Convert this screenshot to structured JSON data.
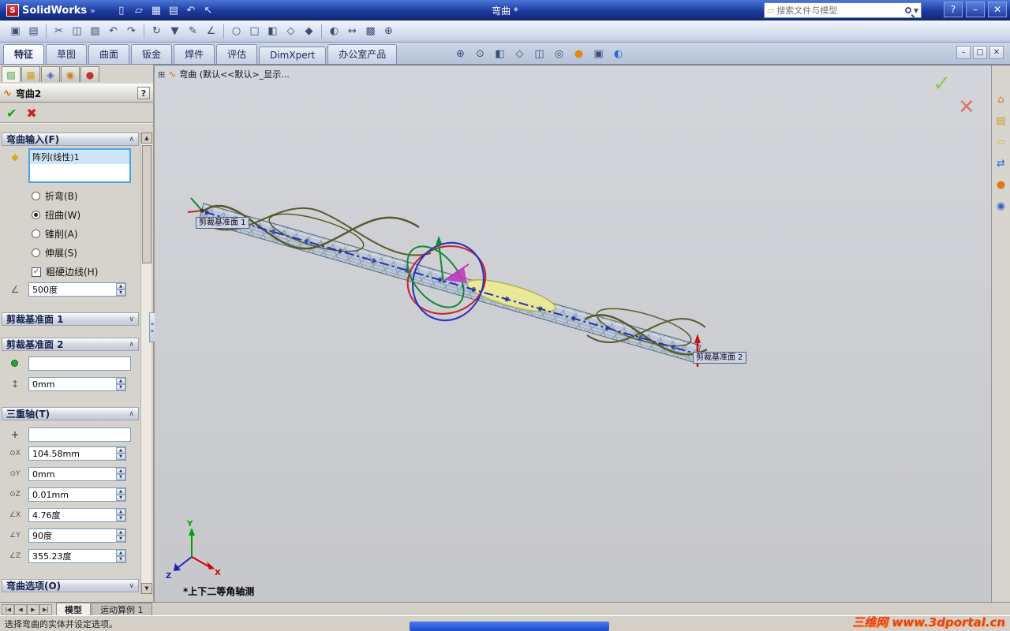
{
  "titlebar": {
    "app_name": "SolidWorks",
    "logo_chevron": "»",
    "doc_title": "弯曲 *",
    "search_placeholder": "搜索文件与模型",
    "icons": [
      {
        "name": "new-icon",
        "glyph": "▯"
      },
      {
        "name": "open-icon",
        "glyph": "▱"
      },
      {
        "name": "save-icon",
        "glyph": "▦"
      },
      {
        "name": "print-icon",
        "glyph": "▤"
      },
      {
        "name": "undo-icon",
        "glyph": "↶"
      },
      {
        "name": "select-icon",
        "glyph": "↖"
      }
    ],
    "window_controls": {
      "help": "?",
      "minimize": "–",
      "close": "✕"
    }
  },
  "toolbar2": {
    "icons": [
      {
        "name": "screen-capture-icon",
        "glyph": "▣"
      },
      {
        "name": "print-preview-icon",
        "glyph": "▤"
      },
      {
        "sep": true
      },
      {
        "name": "cut-icon",
        "glyph": "✂"
      },
      {
        "name": "copy-icon",
        "glyph": "◫"
      },
      {
        "name": "paste-icon",
        "glyph": "▨"
      },
      {
        "name": "undo-icon",
        "glyph": "↶"
      },
      {
        "name": "redo-icon",
        "glyph": "↷"
      },
      {
        "sep": true
      },
      {
        "name": "rebuild-icon",
        "glyph": "↻"
      },
      {
        "name": "selection-filter-icon",
        "glyph": "▼"
      },
      {
        "name": "sketch-icon",
        "glyph": "✎"
      },
      {
        "name": "smart-dimension-icon",
        "glyph": "∠"
      },
      {
        "sep": true
      },
      {
        "name": "circle-tool-icon",
        "glyph": "○"
      },
      {
        "name": "rectangle-tool-icon",
        "glyph": "□"
      },
      {
        "name": "mirror-icon",
        "glyph": "◧"
      },
      {
        "name": "wireframe-icon",
        "glyph": "◇"
      },
      {
        "name": "shaded-icon",
        "glyph": "◆"
      },
      {
        "sep": true
      },
      {
        "name": "section-view-icon",
        "glyph": "◐"
      },
      {
        "name": "measure-icon",
        "glyph": "↔"
      },
      {
        "name": "mass-properties-icon",
        "glyph": "▩"
      },
      {
        "name": "zoom-icon",
        "glyph": "⊕"
      }
    ]
  },
  "command_tabs": {
    "items": [
      {
        "name": "tab-features",
        "label": "特征",
        "active": true
      },
      {
        "name": "tab-sketch",
        "label": "草图"
      },
      {
        "name": "tab-surfaces",
        "label": "曲面"
      },
      {
        "name": "tab-sheet-metal",
        "label": "钣金"
      },
      {
        "name": "tab-weldments",
        "label": "焊件"
      },
      {
        "name": "tab-evaluate",
        "label": "评估"
      },
      {
        "name": "tab-dimxpert",
        "label": "DimXpert"
      },
      {
        "name": "tab-office-products",
        "label": "办公室产品"
      }
    ],
    "doc_controls": {
      "minimize": "–",
      "restore": "□",
      "close": "✕"
    }
  },
  "headsup": {
    "icons": [
      {
        "name": "zoom-fit-icon",
        "glyph": "⊕"
      },
      {
        "name": "zoom-area-icon",
        "glyph": "⊙"
      },
      {
        "name": "section-view-icon",
        "glyph": "◧"
      },
      {
        "name": "view-orientation-icon",
        "glyph": "◇"
      },
      {
        "name": "display-style-icon",
        "glyph": "◫"
      },
      {
        "name": "hide-show-icon",
        "glyph": "◎"
      },
      {
        "name": "edit-appearance-icon",
        "glyph": "●",
        "color": "#e08818"
      },
      {
        "name": "apply-scene-icon",
        "glyph": "▣"
      },
      {
        "name": "view-settings-icon",
        "glyph": "◐",
        "color": "#2a6ad0"
      }
    ]
  },
  "pm": {
    "tabs": [
      {
        "name": "propertymanager-tab",
        "glyph": "▧",
        "color": "#3a9a3a",
        "active": true
      },
      {
        "name": "configurationmanager-tab",
        "glyph": "▦",
        "color": "#caa020"
      },
      {
        "name": "dimxpertmanager-tab",
        "glyph": "◈",
        "color": "#3a62c8"
      },
      {
        "name": "displaymanager-tab",
        "glyph": "◉",
        "color": "#d2781e"
      },
      {
        "name": "appearances-tab",
        "glyph": "●",
        "color": "#c03030"
      }
    ],
    "title": "弯曲2",
    "help": "?",
    "ok": "✔",
    "cancel": "✖",
    "bend_input": {
      "header": "弯曲输入(F)",
      "entity_value": "阵列(线性)1",
      "radios": [
        {
          "name": "radio-bend",
          "label": "折弯(B)"
        },
        {
          "name": "radio-twist",
          "label": "扭曲(W)",
          "checked": true
        },
        {
          "name": "radio-taper",
          "label": "锥削(A)"
        },
        {
          "name": "radio-stretch",
          "label": "伸展(S)"
        }
      ],
      "hard_edges_label": "粗硬边线(H)",
      "hard_edges_check": "✓",
      "angle_value": "500度"
    },
    "trim1": {
      "header": "剪裁基准面 1"
    },
    "trim2": {
      "header": "剪裁基准面 2",
      "plane_value": "",
      "offset_value": "0mm"
    },
    "triad": {
      "header": "三重轴(T)",
      "coord_value": "",
      "rows": [
        {
          "name": "triad-x-translation",
          "glyph": "⊙X",
          "value": "104.58mm"
        },
        {
          "name": "triad-y-translation",
          "glyph": "⊙Y",
          "value": "0mm"
        },
        {
          "name": "triad-z-translation",
          "glyph": "⊙Z",
          "value": "0.01mm"
        },
        {
          "name": "triad-x-rotation",
          "glyph": "∠X",
          "value": "4.76度"
        },
        {
          "name": "triad-y-rotation",
          "glyph": "∠Y",
          "value": "90度"
        },
        {
          "name": "triad-z-rotation",
          "glyph": "∠Z",
          "value": "355.23度"
        }
      ]
    },
    "options": {
      "header": "弯曲选项(O)"
    }
  },
  "viewport": {
    "tree_label": "弯曲 (默认<<默认>_显示...",
    "plane1_label": "剪裁基准面 1",
    "plane2_label": "剪裁基准面  2",
    "view_orientation": "*上下二等角轴测",
    "triad_axes": {
      "x": "X",
      "y": "Y",
      "z": "Z"
    }
  },
  "taskpane": {
    "icons": [
      {
        "name": "solidworks-resources-icon",
        "glyph": "⌂",
        "color": "#d2781e"
      },
      {
        "name": "design-library-icon",
        "glyph": "▤",
        "color": "#caa020"
      },
      {
        "name": "file-explorer-icon",
        "glyph": "▱",
        "color": "#d8b428"
      },
      {
        "name": "solidworks-forum-icon",
        "glyph": "⇄",
        "color": "#2a6ad0"
      },
      {
        "name": "appearances-icon",
        "glyph": "●",
        "color": "#e07818"
      },
      {
        "name": "custom-properties-icon",
        "glyph": "◉",
        "color": "#3a62c8"
      }
    ]
  },
  "bottom": {
    "nav": [
      {
        "name": "rewind-button",
        "glyph": "|◀"
      },
      {
        "name": "prev-button",
        "glyph": "◀"
      },
      {
        "name": "next-button",
        "glyph": "▶"
      },
      {
        "name": "fwd-button",
        "glyph": "▶|"
      }
    ],
    "tabs": [
      {
        "name": "tab-model",
        "label": "模型",
        "active": true
      },
      {
        "name": "tab-motion-study",
        "label": "运动算例 1"
      }
    ],
    "status": "选择弯曲的实体并设定选项。"
  },
  "watermark": "三维网 www.3dportal.cn"
}
